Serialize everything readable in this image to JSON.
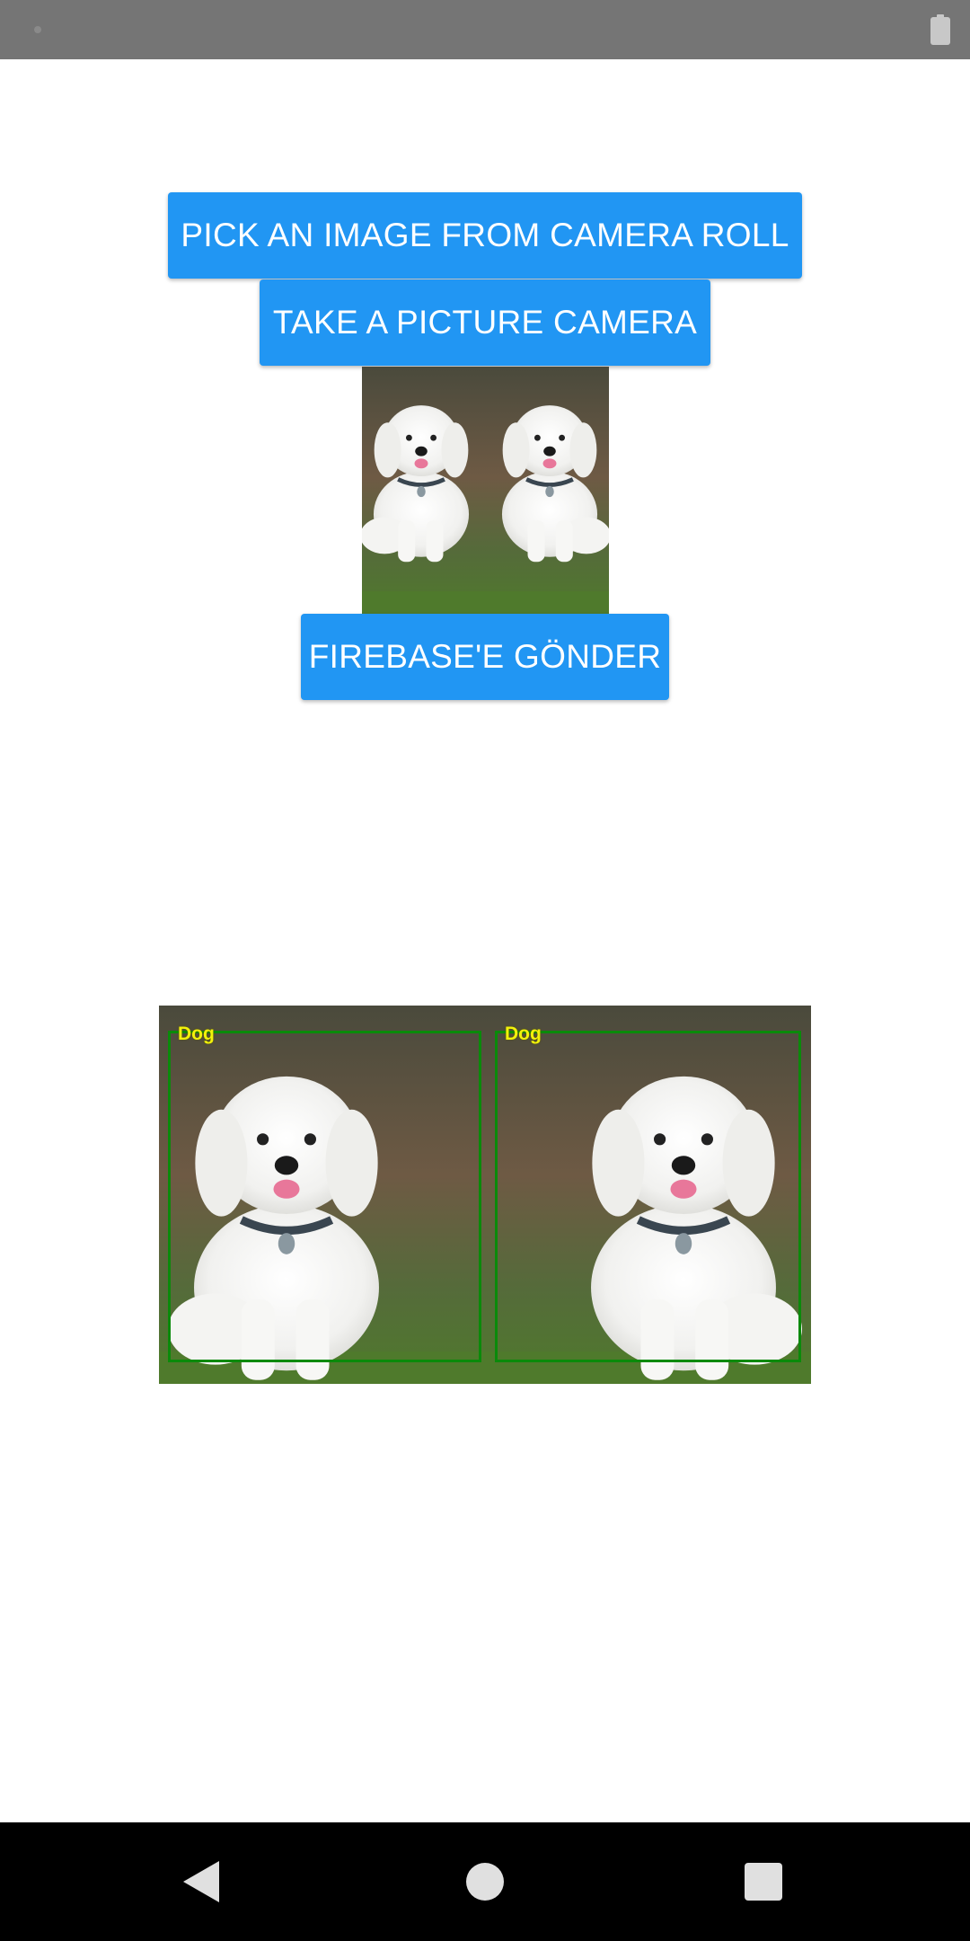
{
  "status_bar": {
    "icons": [
      "notification-dot-icon",
      "battery-icon"
    ]
  },
  "buttons": {
    "pick_image": "PICK AN IMAGE FROM CAMERA ROLL",
    "take_picture": "TAKE A PICTURE CAMERA",
    "send_firebase": "FIREBASE'E GÖNDER"
  },
  "selected_image": {
    "content": "two white fluffy dogs, mirrored"
  },
  "detection_result": {
    "detections": [
      {
        "label": "Dog",
        "box_color": "#0a8a0a",
        "label_color": "#f2f20a"
      },
      {
        "label": "Dog",
        "box_color": "#0a8a0a",
        "label_color": "#f2f20a"
      }
    ]
  },
  "nav_bar": {
    "icons": [
      "back-icon",
      "home-icon",
      "recents-icon"
    ]
  },
  "colors": {
    "button": "#2196F3",
    "status_bar": "#757575",
    "nav_bar": "#000000"
  }
}
